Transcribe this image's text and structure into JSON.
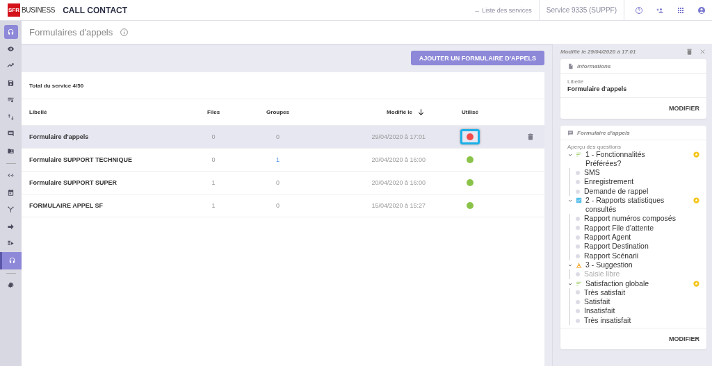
{
  "header": {
    "brand_badge": "SFR",
    "brand_name": "BUSINESS",
    "app_title": "CALL CONTACT",
    "back_link": "← Liste des services",
    "service": "Service 9335 (SUPPF)"
  },
  "sidebar": {
    "items": [
      {
        "kind": "icon",
        "selected": true
      },
      {
        "kind": "icon",
        "selected": false
      },
      {
        "kind": "icon",
        "selected": false
      },
      {
        "kind": "icon",
        "selected": false
      },
      {
        "kind": "icon",
        "selected": false
      },
      {
        "kind": "icon",
        "selected": false
      },
      {
        "kind": "icon",
        "selected": false
      },
      {
        "kind": "icon",
        "selected": false
      },
      {
        "kind": "divider"
      },
      {
        "kind": "icon",
        "selected": false
      },
      {
        "kind": "icon",
        "selected": false
      },
      {
        "kind": "icon",
        "selected": false
      },
      {
        "kind": "icon",
        "selected": false
      },
      {
        "kind": "icon",
        "selected": false
      },
      {
        "kind": "icon",
        "selected": true
      },
      {
        "kind": "divider"
      },
      {
        "kind": "icon",
        "selected": false
      }
    ]
  },
  "page": {
    "title": "Formulaires d'appels",
    "add_button": "AJOUTER UN FORMULAIRE D'APPELS"
  },
  "table": {
    "total": "Total du service 4/50",
    "columns": [
      "Libellé",
      "Files",
      "Groupes",
      "Modifié le",
      "Utilisé"
    ],
    "rows": [
      {
        "label": "Formulaire d'appels",
        "files": "0",
        "groups": "0",
        "groups_link": false,
        "modified": "29/04/2020 à 17:01",
        "color": "#ef4b4b",
        "focused": true,
        "selected": true
      },
      {
        "label": "Formulaire SUPPORT TECHNIQUE",
        "files": "0",
        "groups": "1",
        "groups_link": true,
        "modified": "20/04/2020 à 16:00",
        "color": "#8bc34a",
        "focused": false,
        "selected": false
      },
      {
        "label": "Formulaire SUPPORT SUPER",
        "files": "1",
        "groups": "0",
        "groups_link": false,
        "modified": "20/04/2020 à 16:00",
        "color": "#8bc34a",
        "focused": false,
        "selected": false
      },
      {
        "label": "FORMULAIRE APPEL SF",
        "files": "1",
        "groups": "0",
        "groups_link": false,
        "modified": "15/04/2020 à 15:27",
        "color": "#8bc34a",
        "focused": false,
        "selected": false
      }
    ]
  },
  "details": {
    "modified": "Modifié le 29/04/2020 à 17:01",
    "info_card": {
      "title": "Informations",
      "field_label": "Libellé",
      "field_value": "Formulaire d'appels",
      "button": "MODIFIER"
    },
    "form_card": {
      "title": "Formulaire d'appels",
      "subtitle": "Aperçu des questions",
      "button": "MODIFIER",
      "questions": [
        {
          "kind": "choice",
          "label": "1 - Fonctionnalités Préférées?",
          "expanded": true,
          "starred": true,
          "children": [
            {
              "label": "SMS",
              "disabled": false
            },
            {
              "label": "Enregistrement",
              "disabled": false
            },
            {
              "label": "Demande de rappel",
              "disabled": false
            }
          ]
        },
        {
          "kind": "checkbox",
          "label": "2 - Rapports statistiques consultés",
          "expanded": true,
          "starred": true,
          "children": [
            {
              "label": "Rapport numéros composés",
              "disabled": false
            },
            {
              "label": "Rapport File d'attente",
              "disabled": false
            },
            {
              "label": "Rapport Agent",
              "disabled": false
            },
            {
              "label": "Rapport Destination",
              "disabled": false
            },
            {
              "label": "Rapport Scénarii",
              "disabled": false
            }
          ]
        },
        {
          "kind": "text",
          "label": "3 - Suggestion",
          "expanded": true,
          "starred": false,
          "children": [
            {
              "label": "Saisie libre",
              "disabled": true
            }
          ]
        },
        {
          "kind": "choice",
          "label": "Satisfaction globale",
          "expanded": true,
          "starred": true,
          "children": [
            {
              "label": "Très satisfait",
              "disabled": false
            },
            {
              "label": "Satisfait",
              "disabled": false
            },
            {
              "label": "Insatisfait",
              "disabled": false
            },
            {
              "label": "Très insatisfait",
              "disabled": false
            }
          ]
        }
      ]
    }
  }
}
